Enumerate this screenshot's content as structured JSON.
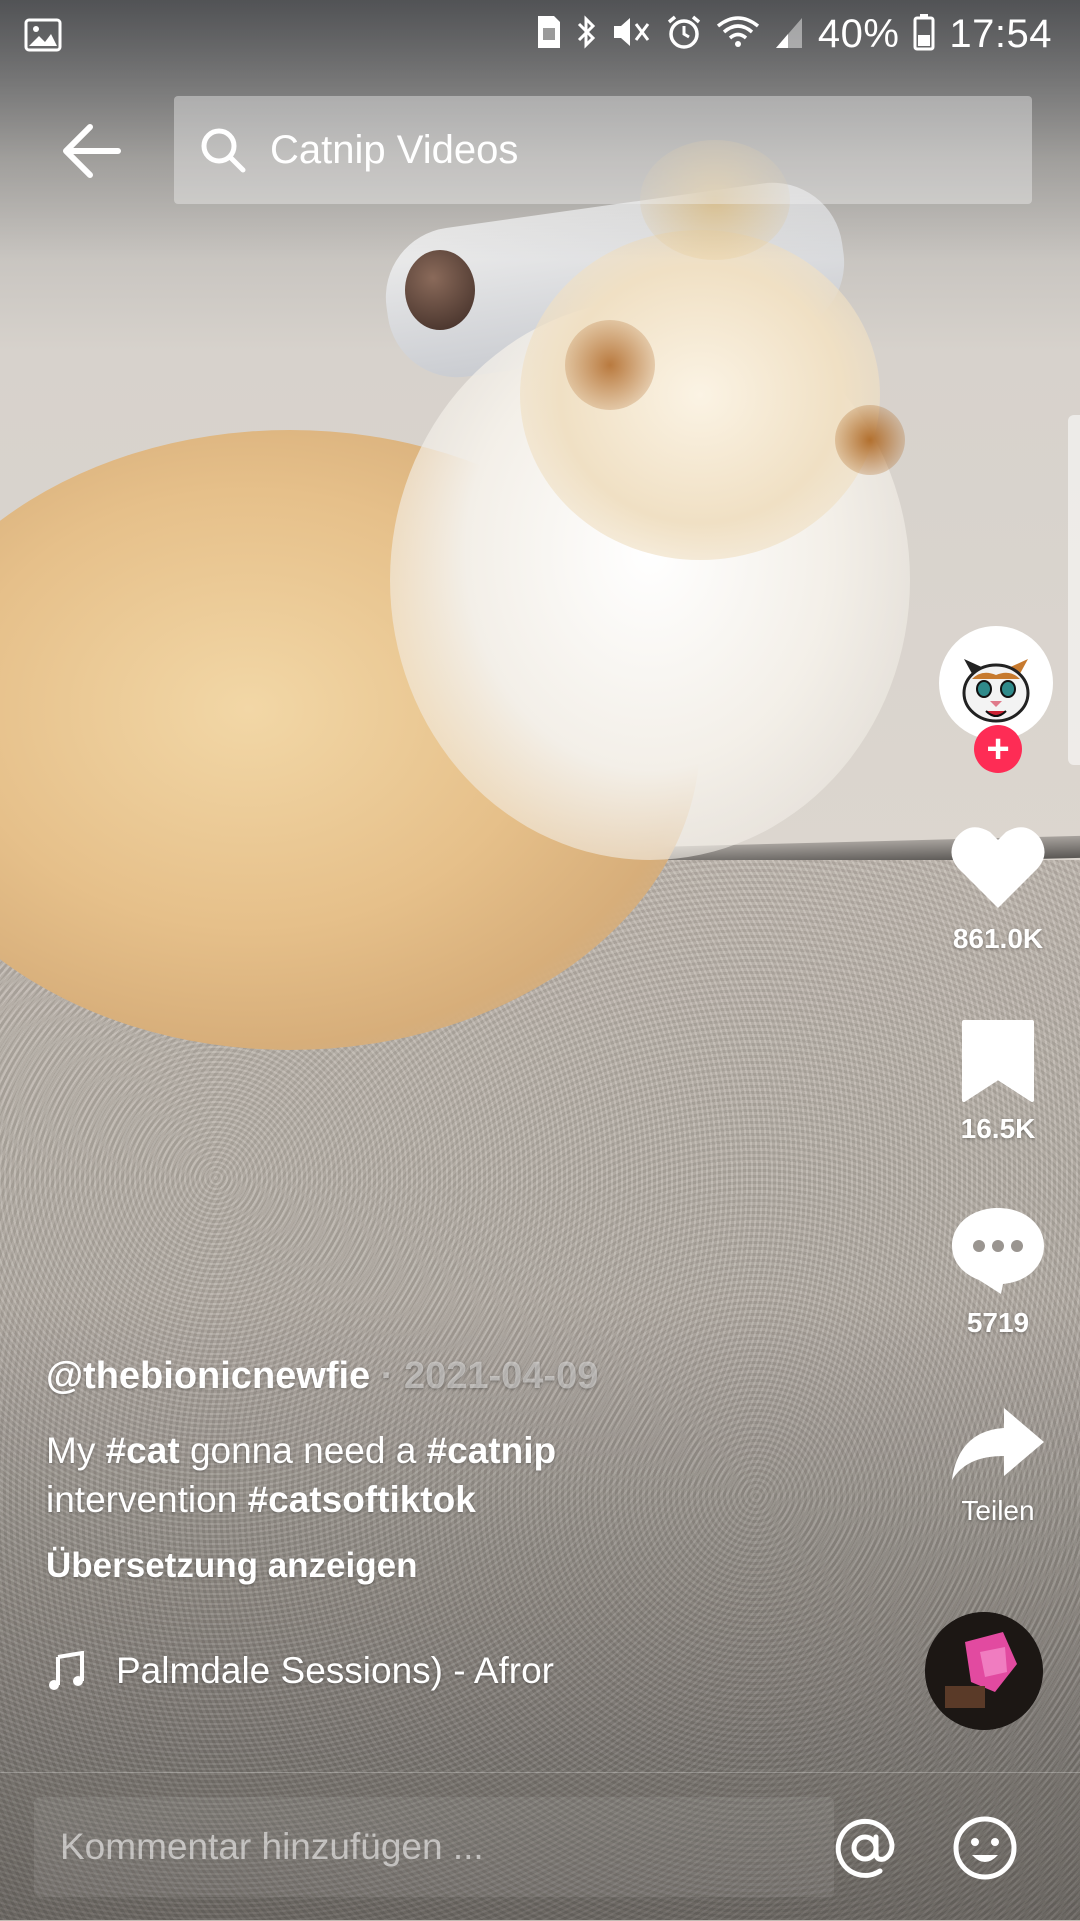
{
  "status_bar": {
    "battery": "40%",
    "time": "17:54"
  },
  "search": {
    "query": "Catnip Videos"
  },
  "actions": {
    "likes": "861.0K",
    "bookmarks": "16.5K",
    "comments": "5719",
    "share": "Teilen"
  },
  "post": {
    "username": "@thebionicnewfie",
    "separator": "·",
    "date": "2021-04-09",
    "desc_1": "My ",
    "tag_cat": "#cat",
    "desc_2": " gonna need a ",
    "tag_catnip": "#catnip",
    "desc_3": "intervention ",
    "tag_catsoftiktok": "#catsoftiktok",
    "translate": "Übersetzung anzeigen",
    "music": "Palmdale Sessions) - Afror"
  },
  "comment": {
    "placeholder": "Kommentar hinzufügen ..."
  },
  "colors": {
    "accent": "#fe2c55",
    "text": "#ffffff"
  },
  "icons": [
    "image-icon",
    "sim-icon",
    "bluetooth-icon",
    "mute-icon",
    "alarm-icon",
    "wifi-icon",
    "signal-icon",
    "battery-icon",
    "back-arrow-icon",
    "search-icon",
    "heart-icon",
    "bookmark-icon",
    "comment-icon",
    "share-icon",
    "music-note-icon",
    "at-icon",
    "emoji-icon"
  ]
}
